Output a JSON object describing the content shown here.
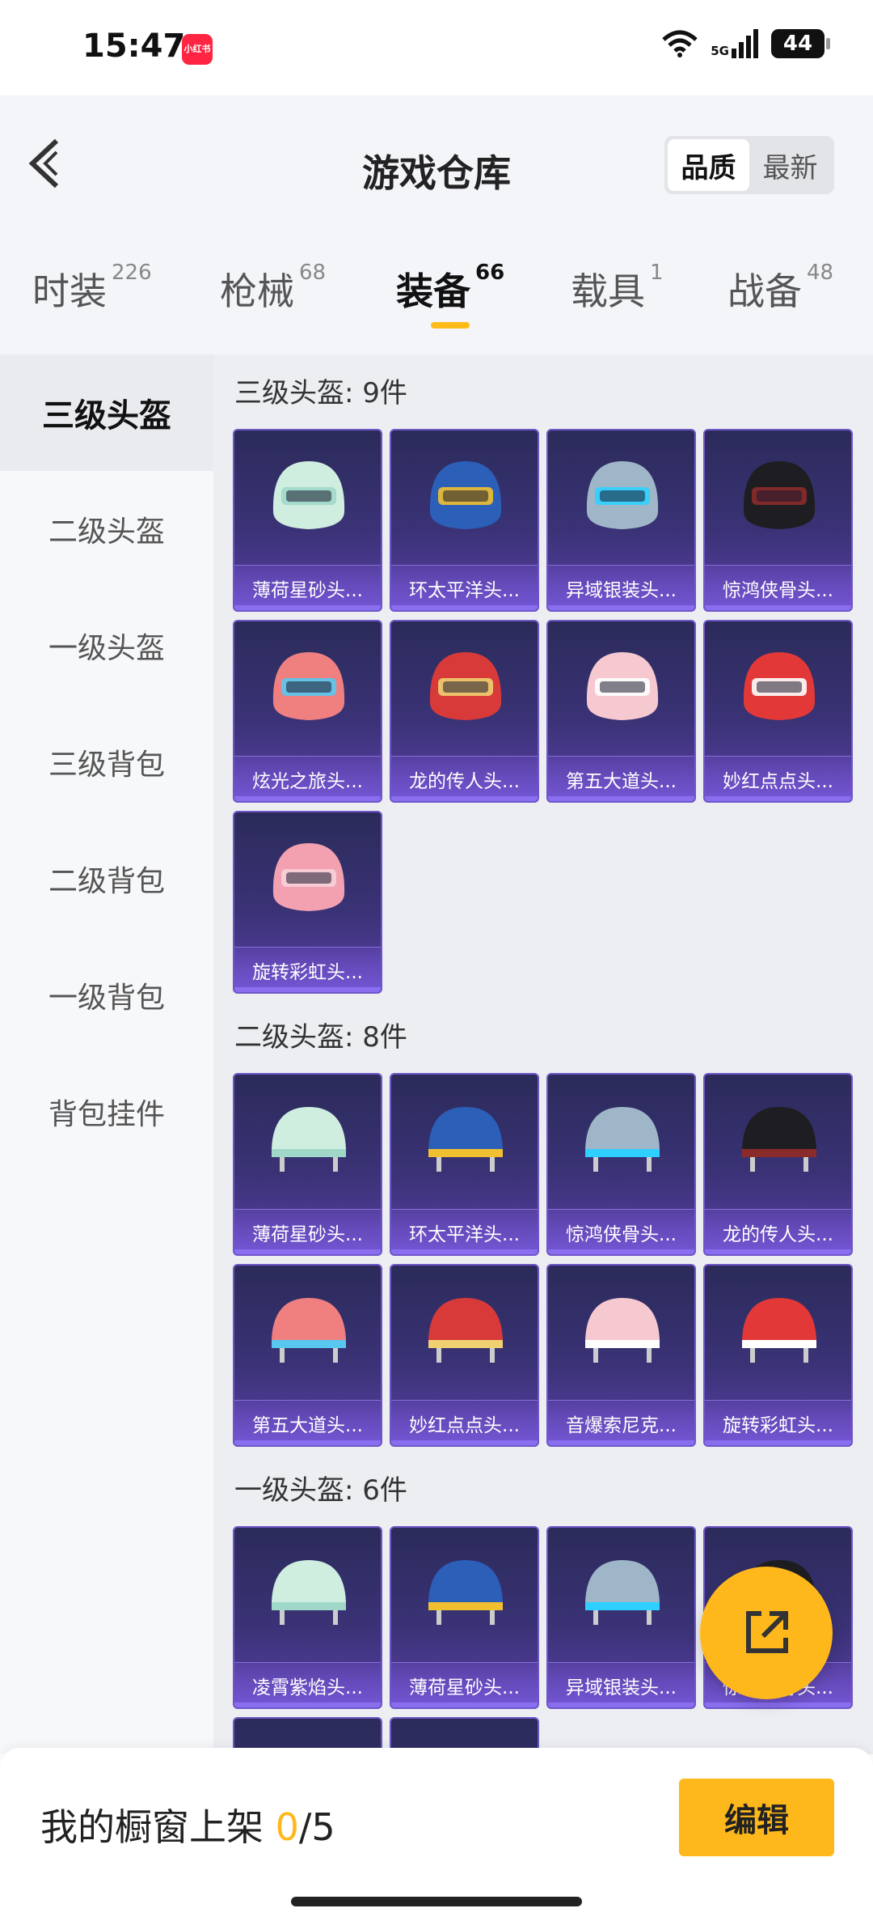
{
  "status": {
    "time": "15:47",
    "app_badge": "小红书",
    "network": "5G",
    "battery": "44"
  },
  "header": {
    "title": "游戏仓库",
    "sort_quality": "品质",
    "sort_latest": "最新"
  },
  "tabs": [
    {
      "label": "时装",
      "count": "226"
    },
    {
      "label": "枪械",
      "count": "68"
    },
    {
      "label": "装备",
      "count": "66"
    },
    {
      "label": "载具",
      "count": "1"
    },
    {
      "label": "战备",
      "count": "48"
    }
  ],
  "sidebar": [
    "三级头盔",
    "二级头盔",
    "一级头盔",
    "三级背包",
    "二级背包",
    "一级背包",
    "背包挂件"
  ],
  "sections": [
    {
      "title": "三级头盔: 9件",
      "items": [
        "薄荷星砂头...",
        "环太平洋头...",
        "异域银装头...",
        "惊鸿侠骨头...",
        "炫光之旅头...",
        "龙的传人头...",
        "第五大道头...",
        "妙红点点头...",
        "旋转彩虹头..."
      ]
    },
    {
      "title": "二级头盔: 8件",
      "items": [
        "薄荷星砂头...",
        "环太平洋头...",
        "惊鸿侠骨头...",
        "龙的传人头...",
        "第五大道头...",
        "妙红点点头...",
        "音爆索尼克...",
        "旋转彩虹头..."
      ]
    },
    {
      "title": "一级头盔: 6件",
      "items": [
        "凌霄紫焰头...",
        "薄荷星砂头...",
        "异域银装头...",
        "惊鸿侠骨头...",
        "",
        ""
      ]
    }
  ],
  "bottom": {
    "showcase_label": "我的橱窗上架 ",
    "current": "0",
    "total": "/5",
    "edit": "编辑"
  }
}
